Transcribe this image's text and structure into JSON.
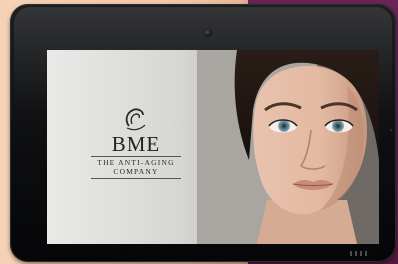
{
  "logo": {
    "name": "BME",
    "tagline_line1": "THE ANTI-AGING",
    "tagline_line2": "COMPANY",
    "icon": "face-profile-icon"
  },
  "photo": {
    "subject": "woman-face-portrait"
  },
  "colors": {
    "background_warm": "#f2c8aa",
    "background_purple": "#5a1e4c",
    "tablet_bezel": "#0c0d0f",
    "screen_light": "#e9e9e7"
  }
}
